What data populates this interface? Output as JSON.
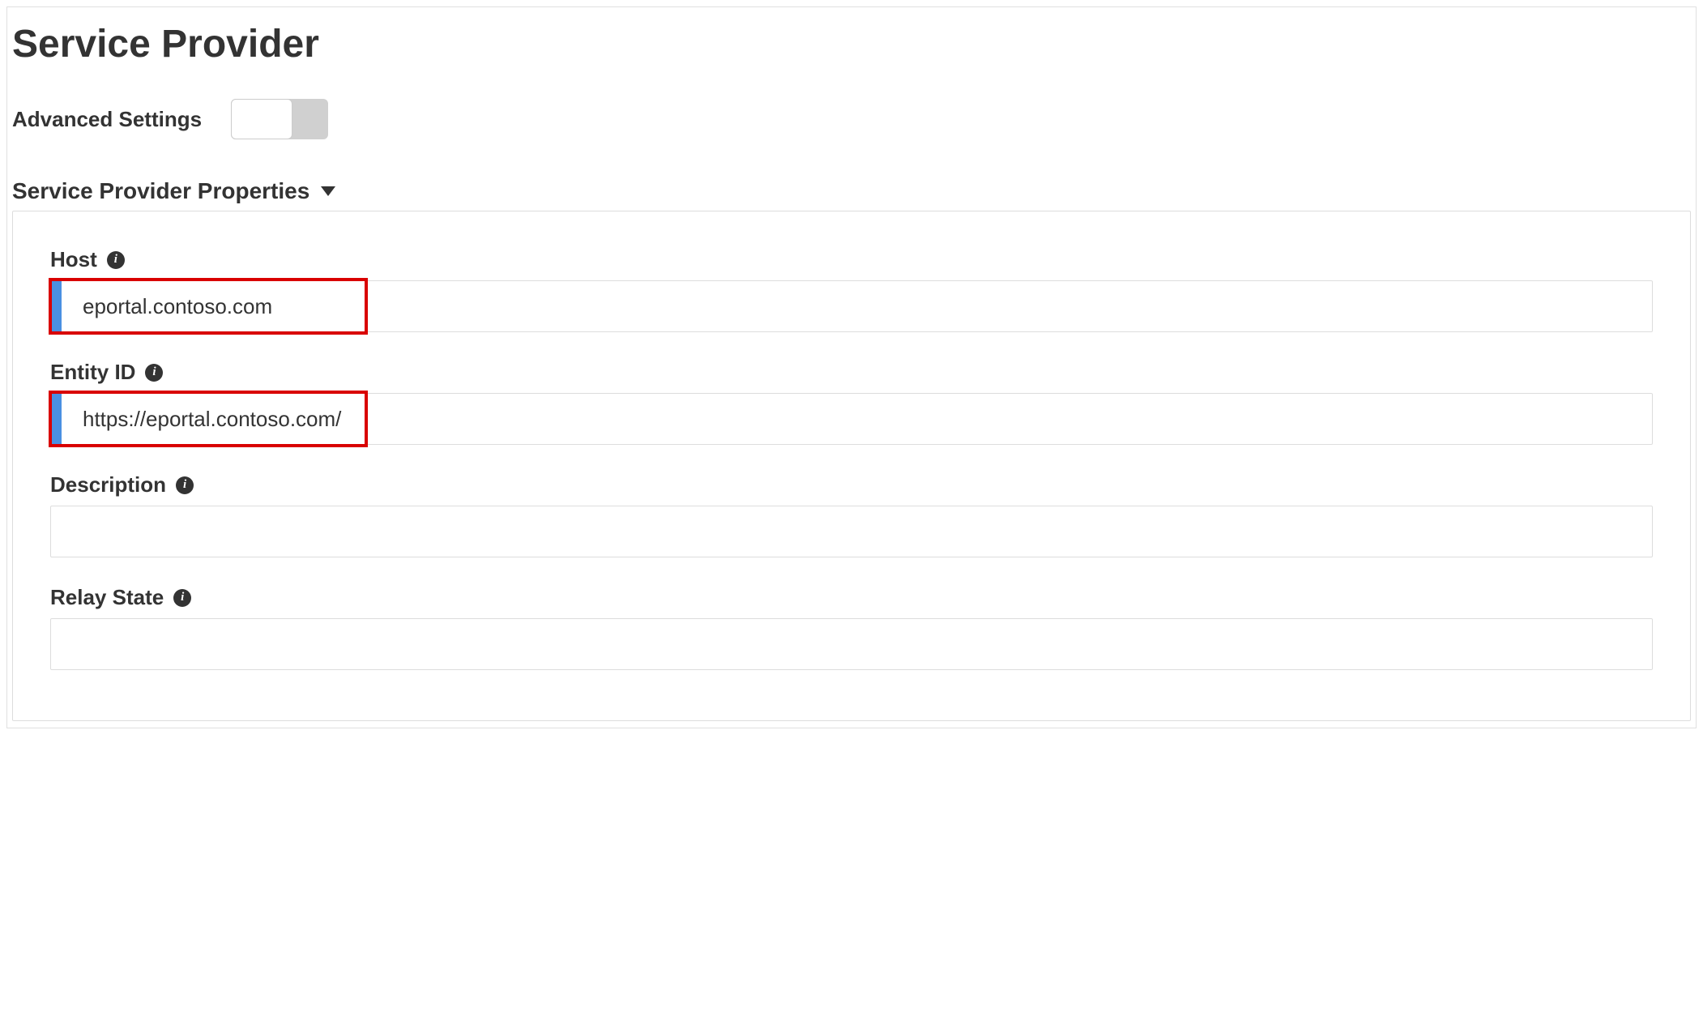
{
  "page": {
    "title": "Service Provider"
  },
  "advanced": {
    "label": "Advanced Settings",
    "enabled": false
  },
  "section": {
    "title": "Service Provider Properties"
  },
  "fields": {
    "host": {
      "label": "Host",
      "value": "eportal.contoso.com",
      "highlighted": true
    },
    "entityId": {
      "label": "Entity ID",
      "value": "https://eportal.contoso.com/",
      "highlighted": true
    },
    "description": {
      "label": "Description",
      "value": ""
    },
    "relayState": {
      "label": "Relay State",
      "value": ""
    }
  }
}
